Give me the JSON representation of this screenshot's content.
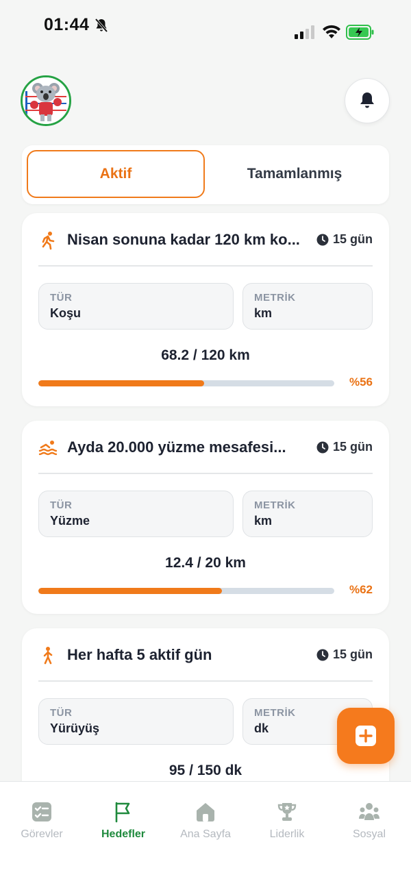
{
  "status_bar": {
    "time": "01:44"
  },
  "tabs": {
    "active": "Aktif",
    "inactive": "Tamamlanmış"
  },
  "goals": [
    {
      "title": "Nisan sonuna kadar 120 km ko...",
      "icon": "running-icon",
      "time_left": "15 gün",
      "type_label": "TÜR",
      "type_value": "Koşu",
      "metric_label": "METRİK",
      "metric_value": "km",
      "progress_text": "68.2 / 120 km",
      "percent_text": "%56",
      "progress_fraction": 0.56
    },
    {
      "title": "Ayda 20.000 yüzme mesafesi...",
      "icon": "swimming-icon",
      "time_left": "15 gün",
      "type_label": "TÜR",
      "type_value": "Yüzme",
      "metric_label": "METRİK",
      "metric_value": "km",
      "progress_text": "12.4 / 20 km",
      "percent_text": "%62",
      "progress_fraction": 0.62
    },
    {
      "title": "Her hafta 5 aktif gün",
      "icon": "walking-icon",
      "time_left": "15 gün",
      "type_label": "TÜR",
      "type_value": "Yürüyüş",
      "metric_label": "METRİK",
      "metric_value": "dk",
      "progress_text": "95 / 150 dk"
    }
  ],
  "nav": {
    "items": [
      {
        "label": "Görevler",
        "icon": "tasks-icon"
      },
      {
        "label": "Hedefler",
        "icon": "flag-icon",
        "active": true
      },
      {
        "label": "Ana Sayfa",
        "icon": "home-icon"
      },
      {
        "label": "Liderlik",
        "icon": "trophy-icon"
      },
      {
        "label": "Sosyal",
        "icon": "people-icon"
      }
    ]
  },
  "colors": {
    "accent": "#f07a1a",
    "active_nav": "#1f8a3d",
    "track": "#d5dde5"
  }
}
